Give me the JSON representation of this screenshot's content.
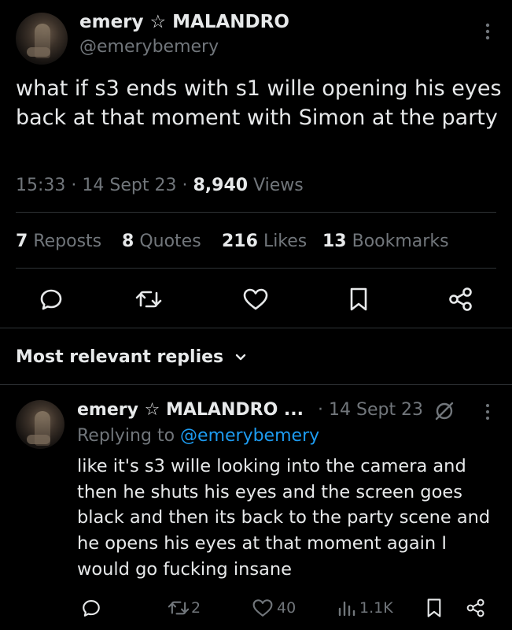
{
  "tweet": {
    "author_name": "emery ☆ MALANDRO",
    "author_handle": "@emerybemery",
    "text": "what if s3 ends with s1 wille opening his eyes back at that moment with Simon at the party",
    "time": "15:33",
    "date": "14 Sept 23",
    "views_count": "8,940",
    "views_label": "Views",
    "reposts_count": "7",
    "reposts_label": "Reposts",
    "quotes_count": "8",
    "quotes_label": "Quotes",
    "likes_count": "216",
    "likes_label": "Likes",
    "bookmarks_count": "13",
    "bookmarks_label": "Bookmarks"
  },
  "replies_header": {
    "label": "Most relevant replies"
  },
  "reply": {
    "author_name": "emery ☆ MALANDRO ...",
    "date": "· 14 Sept 23",
    "replying_prefix": "Replying to",
    "replying_handle": "@emerybemery",
    "text": "like it's s3 wille looking into the camera and then he shuts his eyes and the screen goes black and then its back to the party scene and he opens his eyes at that moment again I would go fucking insane",
    "retweets": "2",
    "likes": "40",
    "views": "1.1K"
  },
  "icons": {
    "reply": "reply-icon",
    "retweet": "retweet-icon",
    "like": "heart-icon",
    "bookmark": "bookmark-icon",
    "share": "share-icon",
    "more": "more-vertical-icon",
    "views": "views-icon",
    "grok": "slashed-circle-icon",
    "chevron": "chevron-down-icon"
  },
  "colors": {
    "background": "#000000",
    "text": "#e7e9ea",
    "muted": "#71767b",
    "link": "#1d9bf0",
    "divider": "#2f3336"
  }
}
